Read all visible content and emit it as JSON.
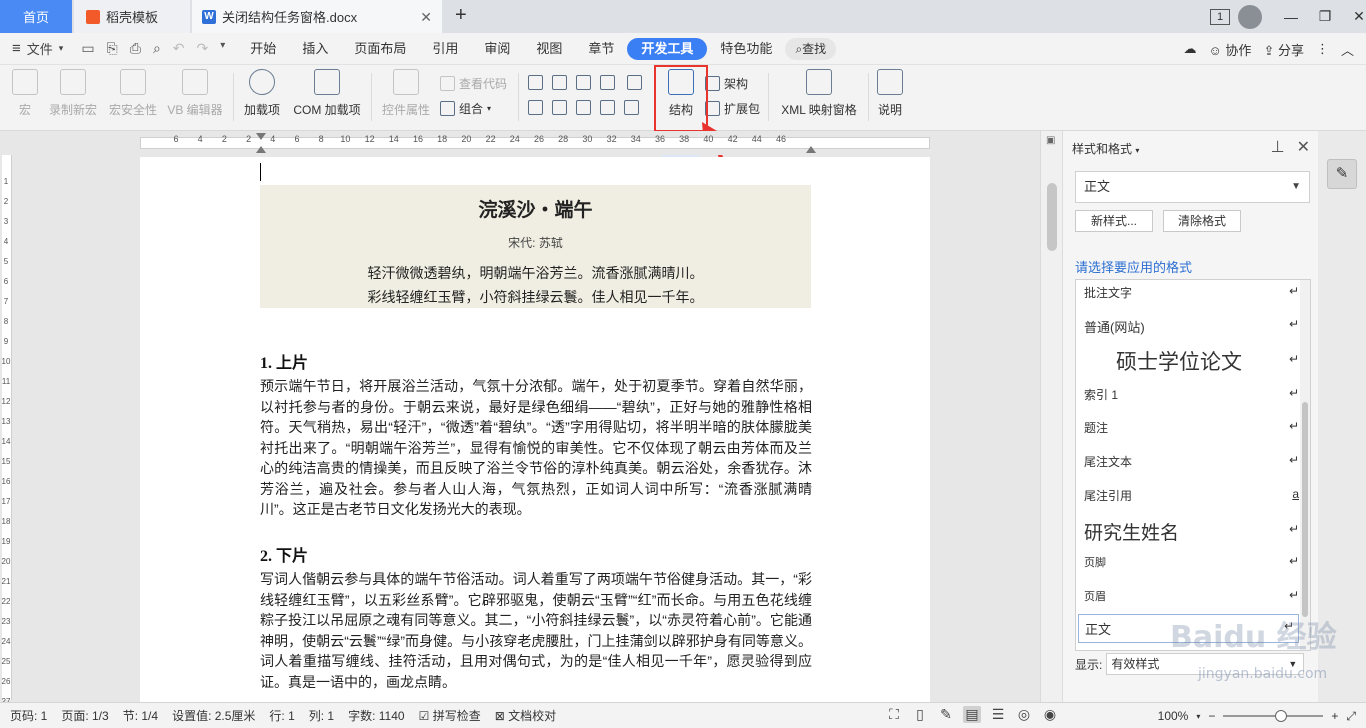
{
  "tabs": [
    {
      "label": "首页"
    },
    {
      "label": "稻壳模板"
    },
    {
      "label": "关闭结构任务窗格.docx"
    }
  ],
  "window": {
    "page_count_badge": "1"
  },
  "menu": {
    "file": "文件",
    "items": [
      "开始",
      "插入",
      "页面布局",
      "引用",
      "审阅",
      "视图",
      "章节",
      "开发工具",
      "特色功能"
    ],
    "active": "开发工具",
    "search": "查找",
    "collab": "协作",
    "share": "分享"
  },
  "ribbon": {
    "macro": "宏",
    "record_macro": "录制新宏",
    "macro_security": "宏安全性",
    "vb_editor": "VB 编辑器",
    "addins": "加载项",
    "com_addins": "COM 加载项",
    "control_props": "控件属性",
    "view_code": "查看代码",
    "combine": "组合",
    "structure": "结构",
    "schema": "架构",
    "expansion": "扩展包",
    "xml_mapping": "XML 映射窗格",
    "help": "说明"
  },
  "ruler": {
    "top_numbers": [
      "6",
      "4",
      "2",
      "2",
      "4",
      "6",
      "8",
      "10",
      "12",
      "14",
      "16",
      "18",
      "20",
      "22",
      "24",
      "26",
      "28",
      "30",
      "32",
      "34",
      "36",
      "38",
      "40",
      "42",
      "44",
      "46"
    ],
    "left_numbers": [
      "1",
      "2",
      "3",
      "4",
      "5",
      "6",
      "7",
      "8",
      "9",
      "10",
      "11",
      "12",
      "13",
      "14",
      "15",
      "16",
      "17",
      "18",
      "19",
      "20",
      "21",
      "22",
      "23",
      "24",
      "25",
      "26",
      "27"
    ]
  },
  "document": {
    "poem_title": "浣溪沙・端午",
    "poem_author": "宋代: 苏轼",
    "poem_line1": "轻汗微微透碧纨，明朝端午浴芳兰。流香涨腻满晴川。",
    "poem_line2": "彩线轻缠红玉臂，小符斜挂绿云鬟。佳人相见一千年。",
    "section1_title": "1. 上片",
    "section1_text": "预示端午节日，将开展浴兰活动，气氛十分浓郁。端午，处于初夏季节。穿着自然华丽，以衬托参与者的身份。于朝云来说，最好是绿色细绢——“碧纨”，正好与她的雅静性格相符。天气稍热，易出“轻汗”，“微透”着“碧纨”。“透”字用得贴切，将半明半暗的肤体朦胧美衬托出来了。“明朝端午浴芳兰”，显得有愉悦的审美性。它不仅体现了朝云由芳体而及兰心的纯洁高贵的情操美，而且反映了浴兰令节俗的淳朴纯真美。朝云浴处，余香犹存。沐芳浴兰，遍及社会。参与者人山人海，气氛热烈，正如词人词中所写：“流香涨腻满晴川”。这正是古老节日文化发扬光大的表现。",
    "section2_title": "2. 下片",
    "section2_text": "写词人偕朝云参与具体的端午节俗活动。词人着重写了两项端午节俗健身活动。其一，“彩线轻缠红玉臂”，以五彩丝系臂”。它辟邪驱鬼，使朝云“玉臂”“红”而长命。与用五色花线缠粽子投江以吊屈原之魂有同等意义。其二，“小符斜挂绿云鬟”，以“赤灵符着心前”。它能通神明，使朝云“云鬟”“绿”而身健。与小孩穿老虎腰肚，门上挂蒲剑以辟邪护身有同等意义。词人着重描写缠线、挂符活动，且用对偶句式，为的是“佳人相见一千年”，愿灵验得到应证。真是一语中的，画龙点睛。"
  },
  "panel": {
    "title": "样式和格式",
    "current_style": "正文",
    "new_style": "新样式...",
    "clear_format": "清除格式",
    "apply_label": "请选择要应用的格式",
    "styles": [
      "批注文字",
      "普通(网站)",
      "硕士学位论文",
      "索引 1",
      "题注",
      "尾注文本",
      "尾注引用",
      "研究生姓名",
      "页脚",
      "页眉",
      "正文"
    ],
    "show_label": "显示:",
    "show_value": "有效样式"
  },
  "status": {
    "page_num": "页码: 1",
    "pages": "页面: 1/3",
    "section": "节: 1/4",
    "setting": "设置值: 2.5厘米",
    "row": "行: 1",
    "col": "列: 1",
    "word_count": "字数: 1140",
    "spell_check": "拼写检查",
    "doc_proof": "文档校对",
    "zoom": "100%"
  },
  "watermark": {
    "main": "Baidu 经验",
    "sub": "jingyan.baidu.com"
  },
  "colors": {
    "accent": "#3b7ff5",
    "highlight": "#e8332e",
    "poem_bg": "#f0eee2"
  }
}
